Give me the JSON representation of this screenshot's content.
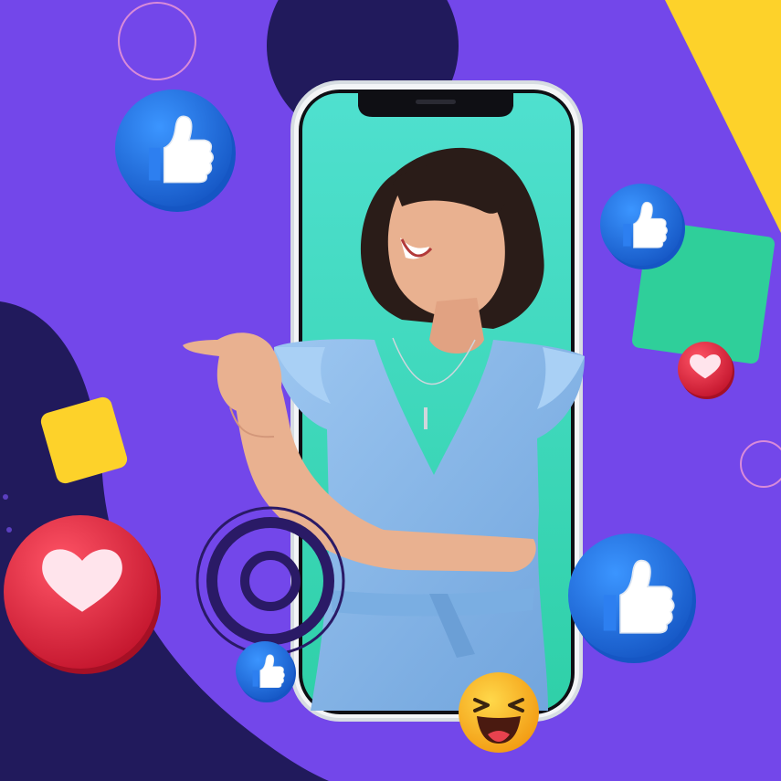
{
  "scene": {
    "colors": {
      "background": "#7347ea",
      "dark_navy": "#211a5c",
      "yellow": "#fdd22a",
      "green": "#2fcf9a",
      "screen_teal": "#3fd9c5",
      "phone_frame": "#e9edf0",
      "like_blue": "#1e74e6",
      "heart_red": "#e8243c",
      "dress_blue": "#8ab8ea",
      "skin": "#e9b190",
      "hair": "#2a1c18",
      "emoji_yellow": "#f8b51f",
      "ring_pink": "#d98bd9"
    },
    "icons": [
      "like-icon",
      "heart-icon",
      "laughing-emoji-icon",
      "outline-circle-icon",
      "target-rings-icon"
    ]
  }
}
